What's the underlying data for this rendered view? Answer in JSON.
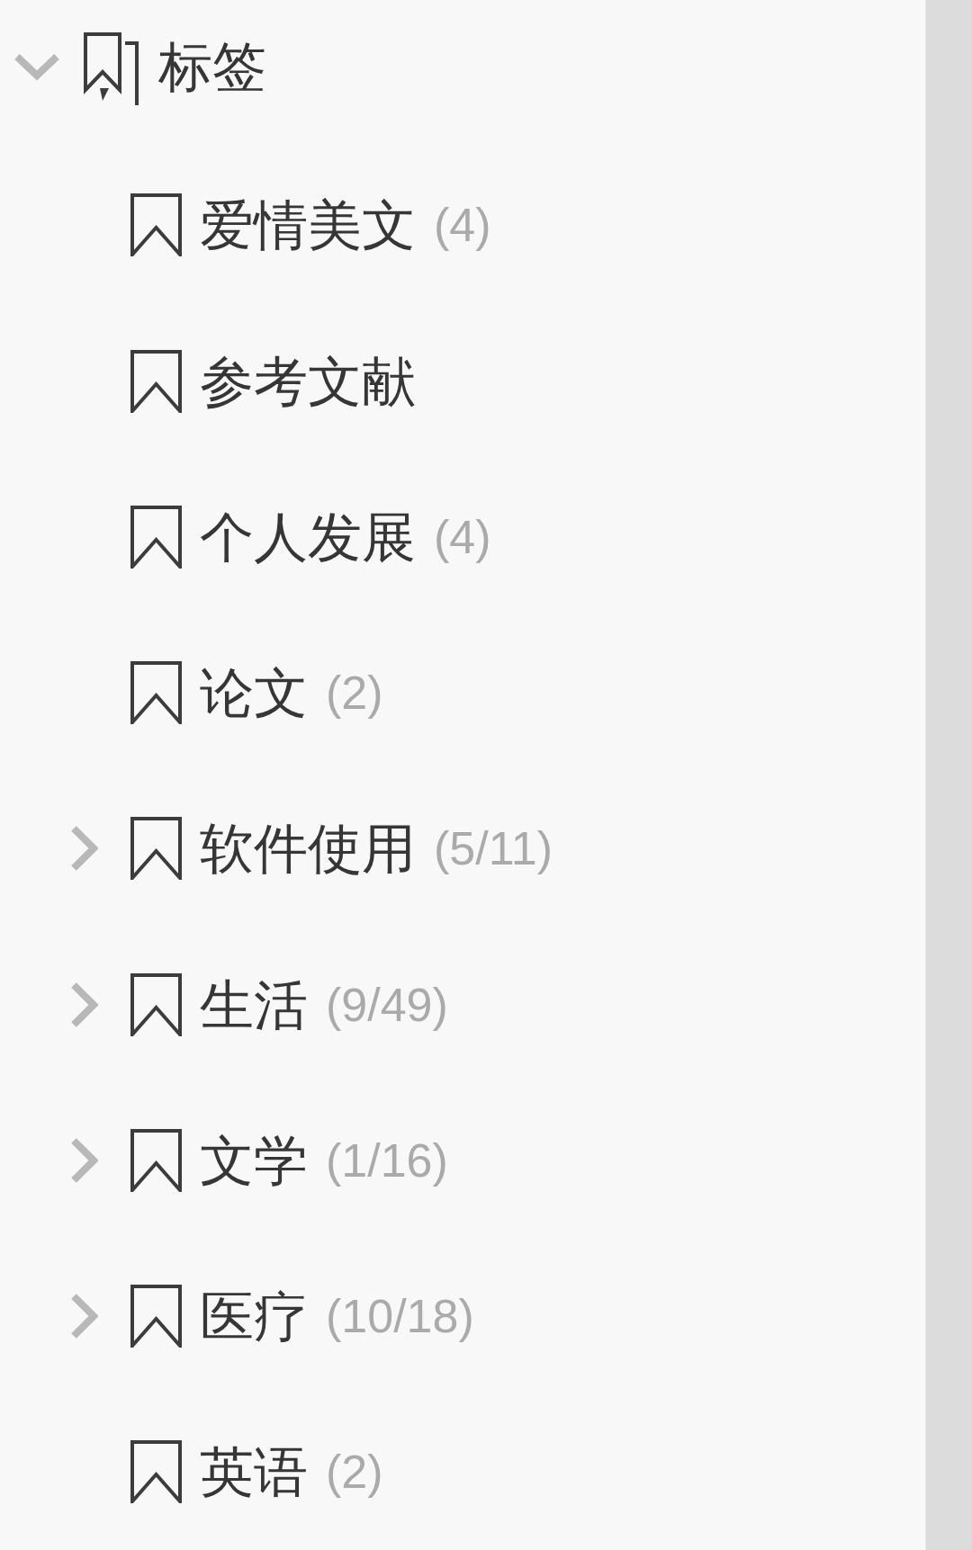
{
  "tag_tree": {
    "label": "标签",
    "expanded": true,
    "children": [
      {
        "label": "爱情美文",
        "count": "(4)",
        "expandable": false,
        "expanded": false
      },
      {
        "label": "参考文献",
        "expandable": false,
        "expanded": false
      },
      {
        "label": "个人发展",
        "count": "(4)",
        "expandable": false,
        "expanded": false
      },
      {
        "label": "论文",
        "count": "(2)",
        "expandable": false,
        "expanded": false
      },
      {
        "label": "软件使用",
        "count": "(5/11)",
        "expandable": true,
        "expanded": false
      },
      {
        "label": "生活",
        "count": "(9/49)",
        "expandable": true,
        "expanded": false
      },
      {
        "label": "文学",
        "count": "(1/16)",
        "expandable": true,
        "expanded": false
      },
      {
        "label": "医疗",
        "count": "(10/18)",
        "expandable": true,
        "expanded": false
      },
      {
        "label": "英语",
        "count": "(2)",
        "expandable": false,
        "expanded": false
      }
    ]
  }
}
